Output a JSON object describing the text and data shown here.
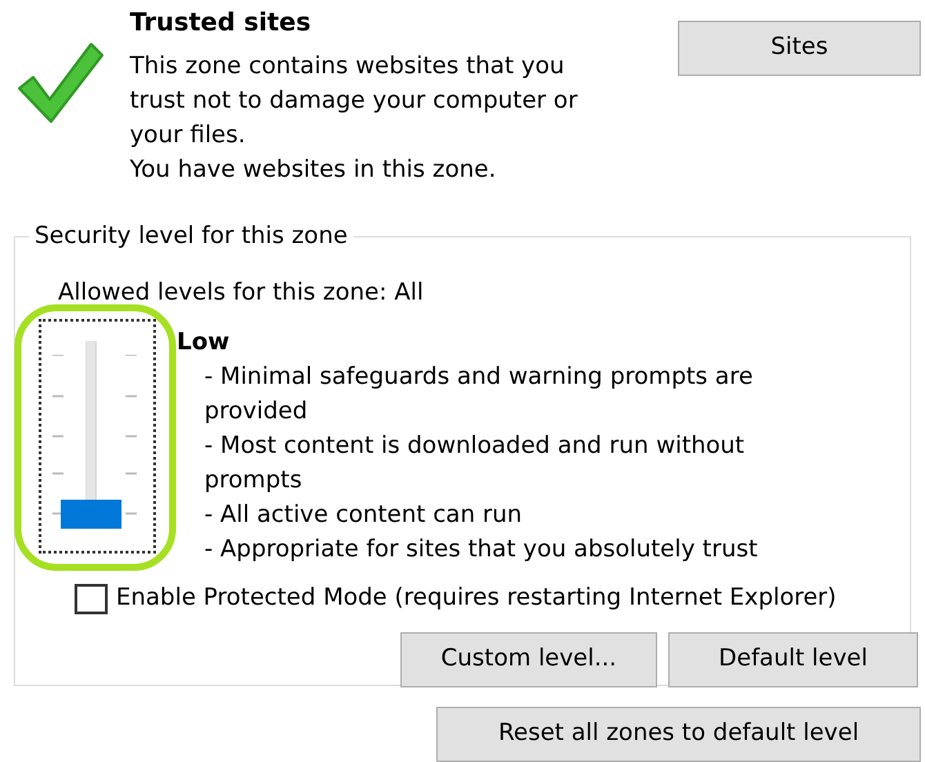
{
  "zone": {
    "title": "Trusted sites",
    "description": "This zone contains websites that you trust not to damage your computer or your files.",
    "status": "You have websites in this zone."
  },
  "sites_button": "Sites",
  "security_group": {
    "legend": "Security level for this zone",
    "allowed_levels": "Allowed levels for this zone: All",
    "slider": {
      "level": 0
    },
    "level_name": "Low",
    "details": [
      {
        "text": "- Minimal safeguards and warning prompts are provided"
      },
      {
        "text": "- Most content is downloaded and run without prompts"
      },
      {
        "text": "- All active content can run"
      },
      {
        "text": "- Appropriate for sites that you absolutely trust"
      }
    ],
    "protected_mode": {
      "label": "Enable Protected Mode (requires restarting Internet Explorer)",
      "checked": false
    },
    "buttons": [
      "Custom level...",
      "Default level"
    ]
  },
  "reset_button": "Reset all zones to default level"
}
